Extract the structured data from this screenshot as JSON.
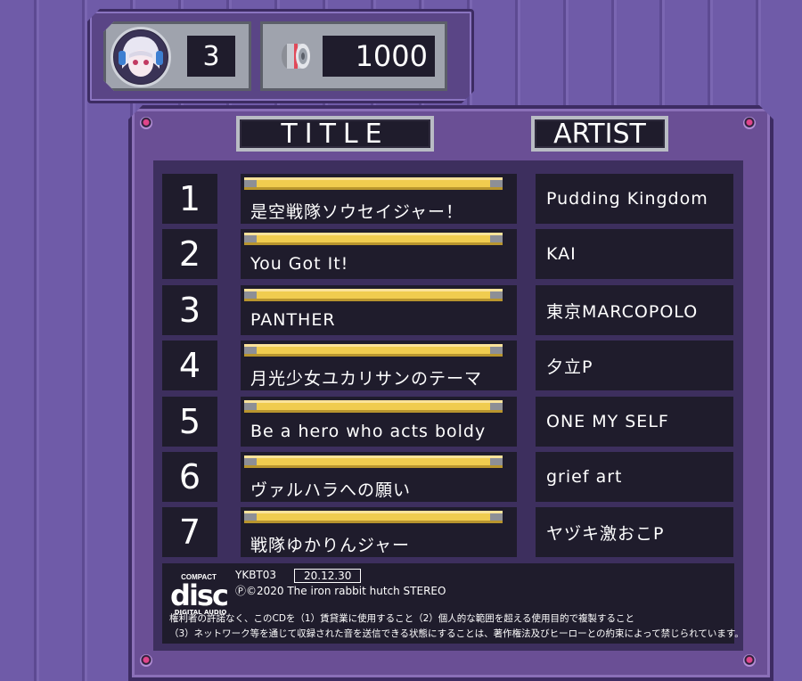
{
  "status": {
    "lives": "3",
    "coins": "1000",
    "avatar_icon": "character-portrait-icon",
    "coin_icon": "speaker-coin-icon"
  },
  "headers": {
    "title": "TITLE",
    "artist": "ARTIST"
  },
  "tracks": [
    {
      "number": "1",
      "title": "是空戦隊ソウセイジャー！",
      "artist": "Pudding Kingdom"
    },
    {
      "number": "2",
      "title": "You Got It!",
      "artist": "KAI"
    },
    {
      "number": "3",
      "title": "PANTHER",
      "artist": "東京MARCOPOLO"
    },
    {
      "number": "4",
      "title": "月光少女ユカリサンのテーマ",
      "artist": "夕立P"
    },
    {
      "number": "5",
      "title": "Be a hero who acts boldy",
      "artist": "ONE MY SELF"
    },
    {
      "number": "6",
      "title": "ヴァルハラへの願い",
      "artist": "grief art"
    },
    {
      "number": "7",
      "title": "戦隊ゆかりんジャー",
      "artist": "ヤヅキ激おこP"
    }
  ],
  "footer": {
    "logo_top": "COMPACT",
    "logo_word": "disc",
    "logo_bottom": "DIGITAL AUDIO",
    "catalog_number": "YKBT03",
    "date": "20.12.30",
    "copyright": "Ⓟ©2020 The iron rabbit hutch STEREO",
    "notice_line1": "権利者の許諾なく、このCDを（1）賃貸業に使用すること（2）個人的な範囲を超える使用目的で複製すること",
    "notice_line2": "（3）ネットワーク等を通じて収録された音を送信できる状態にすることは、著作権法及びヒーローとの約束によって禁じられています。"
  },
  "colors": {
    "background": "#6e5aa6",
    "panel": "#6a4f95",
    "cell": "#1f1c2c",
    "bar_yellow": "#f0cc4f",
    "screw_accent": "#e0458a"
  }
}
